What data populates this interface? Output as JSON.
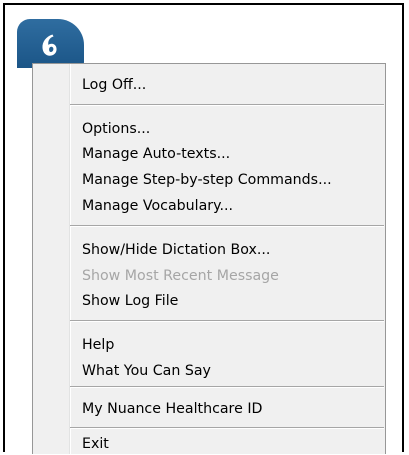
{
  "app": {
    "icon": "dragon-app-icon",
    "brand_color": "#1f5b8e"
  },
  "menu": {
    "groups": [
      [
        {
          "label": "Log Off...",
          "enabled": true
        }
      ],
      [
        {
          "label": "Options...",
          "enabled": true
        },
        {
          "label": "Manage Auto-texts...",
          "enabled": true
        },
        {
          "label": "Manage Step-by-step Commands...",
          "enabled": true
        },
        {
          "label": "Manage Vocabulary...",
          "enabled": true
        }
      ],
      [
        {
          "label": "Show/Hide Dictation Box...",
          "enabled": true
        },
        {
          "label": "Show Most Recent Message",
          "enabled": false
        },
        {
          "label": "Show Log File",
          "enabled": true
        }
      ],
      [
        {
          "label": "Help",
          "enabled": true
        },
        {
          "label": "What You Can Say",
          "enabled": true
        }
      ],
      [
        {
          "label": "My Nuance Healthcare ID",
          "enabled": true
        }
      ],
      [
        {
          "label": "Exit",
          "enabled": true
        }
      ]
    ]
  }
}
